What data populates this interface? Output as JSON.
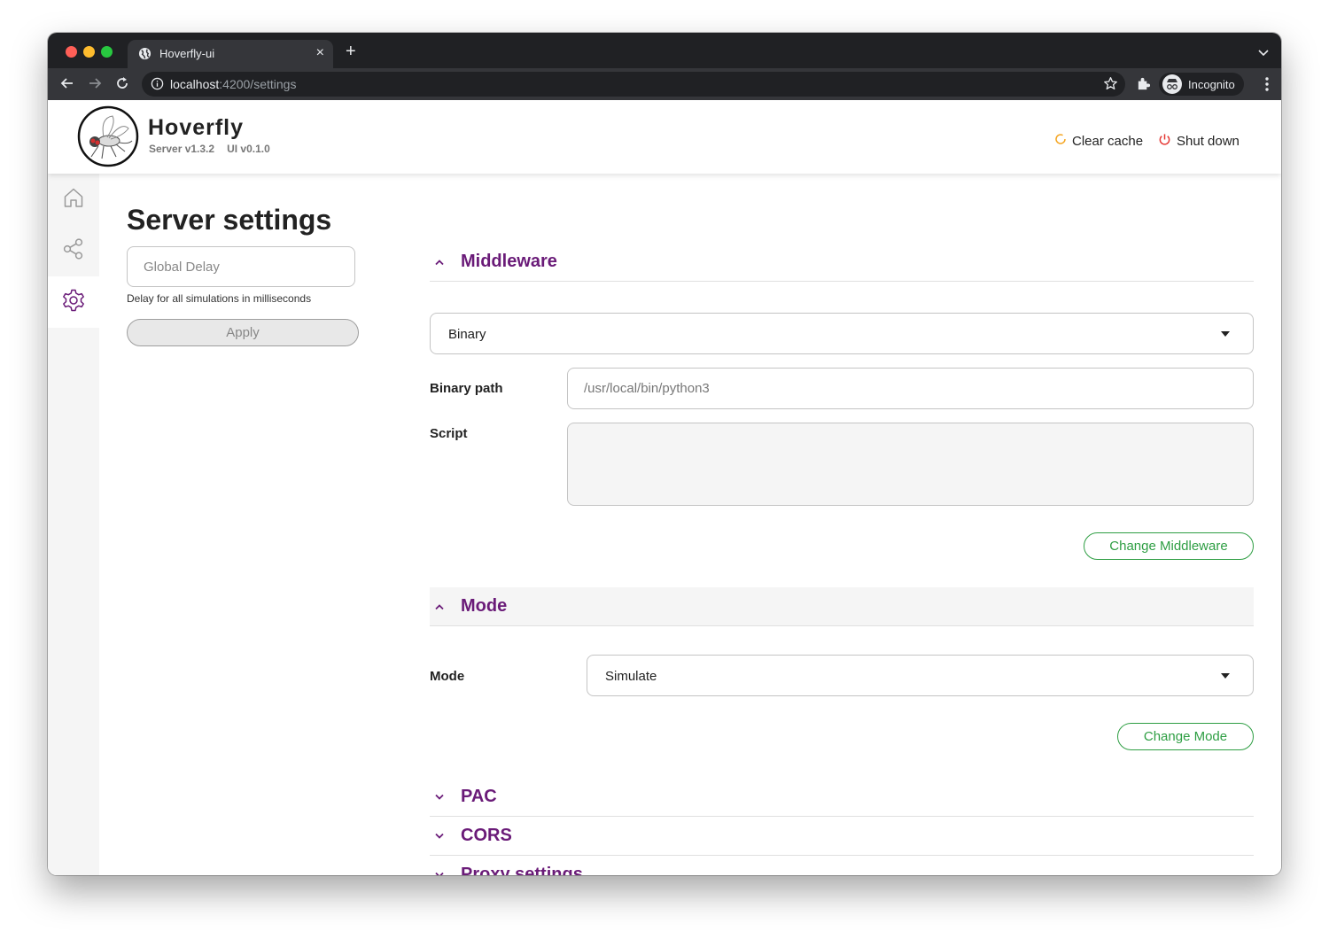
{
  "browser": {
    "tab_title": "Hoverfly-ui",
    "url_host": "localhost",
    "url_path": ":4200/settings",
    "profile_label": "Incognito",
    "traffic_lights": [
      "#ff5f57",
      "#febc2e",
      "#28c840"
    ]
  },
  "header": {
    "brand": "Hoverfly",
    "server_version": "Server v1.3.2",
    "ui_version": "UI v0.1.0",
    "clear_cache_label": "Clear cache",
    "shut_down_label": "Shut down"
  },
  "sidebar": {
    "items": [
      {
        "icon": "home-icon",
        "active": false
      },
      {
        "icon": "share-icon",
        "active": false
      },
      {
        "icon": "gear-icon",
        "active": true
      }
    ]
  },
  "settings": {
    "title": "Server settings",
    "global_delay_placeholder": "Global Delay",
    "global_delay_hint": "Delay for all simulations in milliseconds",
    "apply_label": "Apply"
  },
  "middleware": {
    "title": "Middleware",
    "type_value": "Binary",
    "binary_path_label": "Binary path",
    "binary_path_placeholder": "/usr/local/bin/python3",
    "script_label": "Script",
    "change_label": "Change Middleware"
  },
  "mode": {
    "title": "Mode",
    "mode_label": "Mode",
    "mode_value": "Simulate",
    "change_label": "Change Mode"
  },
  "sections": {
    "pac": "PAC",
    "cors": "CORS",
    "proxy": "Proxy settings"
  },
  "colors": {
    "accent_purple": "#6a1b78",
    "success_green": "#2e9e43",
    "clear_cache_orange": "#f5a623",
    "shutdown_red": "#e53935"
  }
}
